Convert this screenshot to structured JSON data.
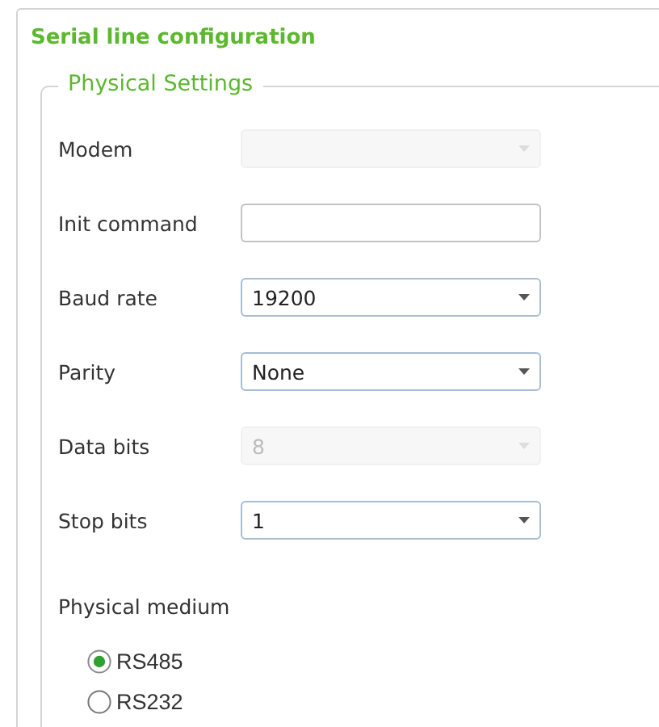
{
  "panel": {
    "title": "Serial line configuration"
  },
  "group": {
    "legend": "Physical Settings",
    "fields": [
      {
        "label": "Modem",
        "kind": "combo",
        "disabled": true
      },
      {
        "label": "Init command",
        "kind": "text",
        "disabled": false
      },
      {
        "label": "Baud rate",
        "kind": "combo",
        "value": "19200",
        "disabled": false
      },
      {
        "label": "Parity",
        "kind": "combo",
        "value": "None",
        "disabled": false
      },
      {
        "label": "Data bits",
        "kind": "combo",
        "value": "8",
        "disabled": true
      },
      {
        "label": "Stop bits",
        "kind": "combo",
        "value": "1",
        "disabled": false
      }
    ],
    "medium": {
      "label": "Physical medium",
      "options": [
        {
          "label": "RS485",
          "selected": true
        },
        {
          "label": "RS232",
          "selected": false
        }
      ]
    }
  }
}
